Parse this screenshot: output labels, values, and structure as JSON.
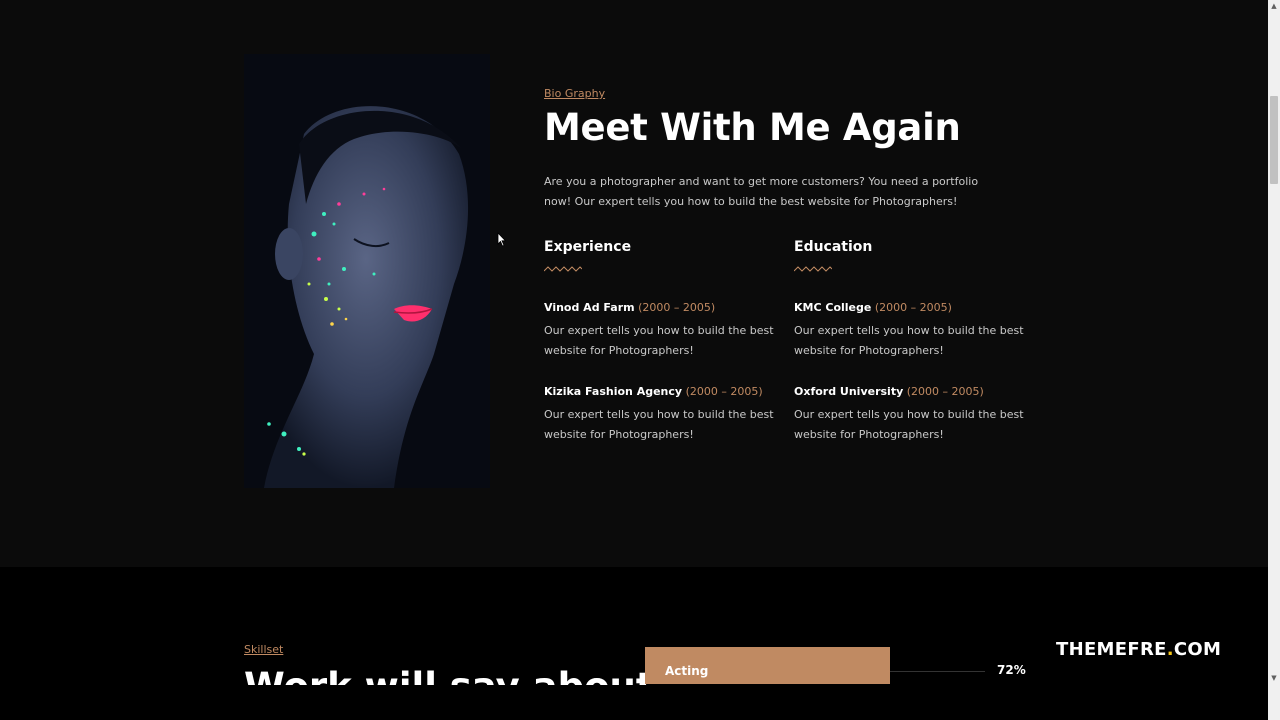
{
  "bio": {
    "eyebrow": "Bio Graphy",
    "headline": "Meet With Me Again",
    "intro": "Are you a photographer and want to get more customers? You need a portfolio now! Our expert tells you how to build the best website for Photographers!",
    "experience": {
      "title": "Experience",
      "entries": [
        {
          "org": "Vinod Ad Farm",
          "years": "(2000 – 2005)",
          "desc": "Our expert tells you how to build the best website for Photographers!"
        },
        {
          "org": "Kizika Fashion Agency",
          "years": "(2000 – 2005)",
          "desc": "Our expert tells you how to build the best website for Photographers!"
        }
      ]
    },
    "education": {
      "title": "Education",
      "entries": [
        {
          "org": "KMC College",
          "years": "(2000 – 2005)",
          "desc": "Our expert tells you how to build the best website for Photographers!"
        },
        {
          "org": "Oxford University",
          "years": "(2000 – 2005)",
          "desc": "Our expert tells you how to build the best website for Photographers!"
        }
      ]
    }
  },
  "skills": {
    "eyebrow": "Skillset",
    "title": "Work will say about",
    "items": [
      {
        "label": "Acting",
        "percent_text": "72%",
        "level": 0.72
      }
    ]
  },
  "watermark": {
    "brand": "THEMEFRE",
    "dot": ".",
    "tld": "COM"
  },
  "colors": {
    "accent": "#c08a62",
    "background": "#0b0b0b",
    "watermark_dot": "#f5c518"
  },
  "icons": {
    "portrait": "woman-neon-paint-portrait",
    "zigzag": "zigzag-divider-icon",
    "cursor": "mouse-pointer-icon"
  }
}
